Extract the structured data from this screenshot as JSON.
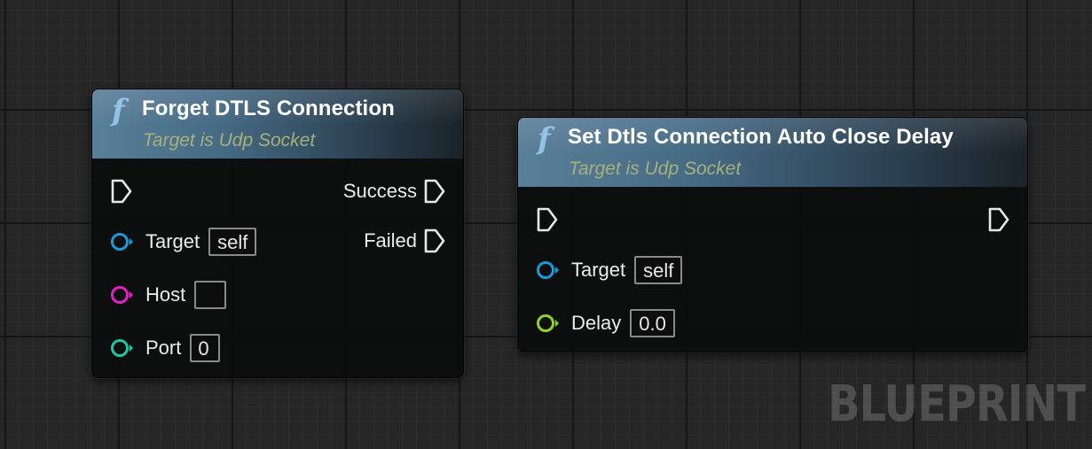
{
  "nodes": [
    {
      "title": "Forget DTLS Connection",
      "subtitle": "Target is Udp Socket",
      "icon": "function-icon",
      "outputs": [
        {
          "label": "Success",
          "type": "exec"
        },
        {
          "label": "Failed",
          "type": "exec"
        }
      ],
      "inputs": [
        {
          "label": "",
          "type": "exec"
        },
        {
          "label": "Target",
          "type": "object",
          "color": "#1a9ad6",
          "value": "self"
        },
        {
          "label": "Host",
          "type": "string",
          "color": "#e21ec8",
          "value": ""
        },
        {
          "label": "Port",
          "type": "int",
          "color": "#1ec6a4",
          "value": "0"
        }
      ]
    },
    {
      "title": "Set Dtls Connection Auto Close Delay",
      "subtitle": "Target is Udp Socket",
      "icon": "function-icon",
      "outputs": [
        {
          "label": "",
          "type": "exec"
        }
      ],
      "inputs": [
        {
          "label": "",
          "type": "exec"
        },
        {
          "label": "Target",
          "type": "object",
          "color": "#1a9ad6",
          "value": "self"
        },
        {
          "label": "Delay",
          "type": "float",
          "color": "#8fd326",
          "value": "0.0"
        }
      ]
    }
  ],
  "watermark": "BLUEPRINT",
  "colors": {
    "exec_pin": "#e8e8e8",
    "header_start": "#5a7f98",
    "header_end": "#1b2228",
    "subtitle": "#a8b07a"
  }
}
